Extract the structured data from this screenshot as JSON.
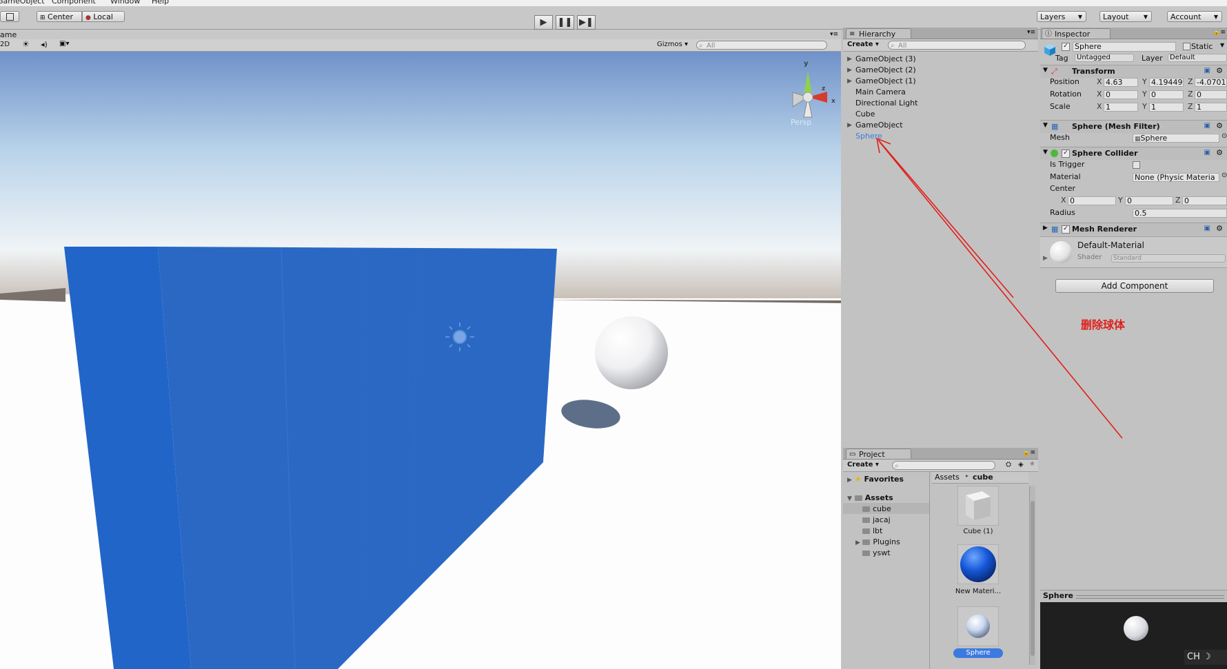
{
  "menu": [
    "GameObject",
    "Component",
    "Window",
    "Help"
  ],
  "toolbar": {
    "center_label": "Center",
    "local_label": "Local",
    "layers_label": "Layers",
    "layout_label": "Layout",
    "account_label": "Account"
  },
  "scene": {
    "tab_label": "ame",
    "mode_2d": "2D",
    "gizmos_label": "Gizmos",
    "search_placeholder": "All",
    "persp_label": "Persp",
    "gizmo_axes": [
      "y",
      "z",
      "x"
    ]
  },
  "hierarchy": {
    "tab_label": "Hierarchy",
    "create_label": "Create",
    "search_placeholder": "All",
    "items": [
      {
        "label": "GameObject (3)",
        "expandable": true
      },
      {
        "label": "GameObject (2)",
        "expandable": true
      },
      {
        "label": "GameObject (1)",
        "expandable": true
      },
      {
        "label": "Main Camera",
        "expandable": false
      },
      {
        "label": "Directional Light",
        "expandable": false
      },
      {
        "label": "Cube",
        "expandable": false
      },
      {
        "label": "GameObject",
        "expandable": true
      },
      {
        "label": "Sphere",
        "expandable": false,
        "selected": true
      }
    ]
  },
  "project": {
    "tab_label": "Project",
    "create_label": "Create",
    "favorites_label": "Favorites",
    "assets_label": "Assets",
    "folders": [
      "cube",
      "jacaj",
      "lbt",
      "Plugins",
      "yswt"
    ],
    "breadcrumb": [
      "Assets",
      "cube"
    ],
    "assets": [
      {
        "label": "Cube (1)"
      },
      {
        "label": "New Materi..."
      },
      {
        "label": "Sphere",
        "selected": true
      }
    ]
  },
  "inspector": {
    "tab_label": "Inspector",
    "object_name": "Sphere",
    "static_label": "Static",
    "tag_label": "Tag",
    "tag_value": "Untagged",
    "layer_label": "Layer",
    "layer_value": "Default",
    "transform": {
      "title": "Transform",
      "position_label": "Position",
      "rotation_label": "Rotation",
      "scale_label": "Scale",
      "position": [
        "4.63",
        "4.19449",
        "-4.0701"
      ],
      "rotation": [
        "0",
        "0",
        "0"
      ],
      "scale": [
        "1",
        "1",
        "1"
      ]
    },
    "mesh_filter": {
      "title": "Sphere (Mesh Filter)",
      "mesh_label": "Mesh",
      "mesh_value": "Sphere"
    },
    "sphere_collider": {
      "title": "Sphere Collider",
      "is_trigger_label": "Is Trigger",
      "material_label": "Material",
      "material_value": "None (Physic Materia",
      "center_label": "Center",
      "center": [
        "0",
        "0",
        "0"
      ],
      "radius_label": "Radius",
      "radius_value": "0.5"
    },
    "mesh_renderer": {
      "title": "Mesh Renderer"
    },
    "material": {
      "name": "Default-Material",
      "shader_label": "Shader",
      "shader_value": "Standard"
    },
    "add_component_label": "Add Component",
    "preview_title": "Sphere"
  },
  "annotation": {
    "text": "删除球体",
    "color": "#e0201c"
  },
  "ime": {
    "label": "CH"
  },
  "colors": {
    "selection": "#3d7ae0",
    "cube_blue": "#2265c9"
  }
}
